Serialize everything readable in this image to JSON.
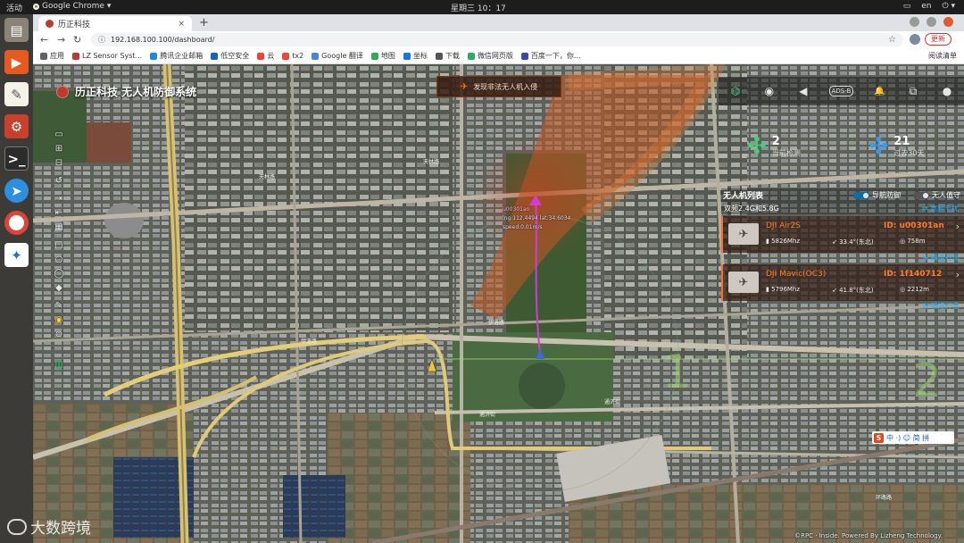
{
  "system_bar": {
    "activities": "活动",
    "app_name": "Google Chrome",
    "clock": "星期三 10：17",
    "lang": "en"
  },
  "browser": {
    "tab_title": "历正科技",
    "tab_close": "×",
    "new_tab": "+",
    "url": "192.168.100.100/dashboard/",
    "update_label": "更新",
    "bookmarks": [
      {
        "label": "应用",
        "color": "#5f6368"
      },
      {
        "label": "LZ Sensor Syst...",
        "color": "#c0392b"
      },
      {
        "label": "腾讯企业邮箱",
        "color": "#1e88e5"
      },
      {
        "label": "低空安全",
        "color": "#1565c0"
      },
      {
        "label": "云",
        "color": "#f44336"
      },
      {
        "label": "tx2",
        "color": "#f44336"
      },
      {
        "label": "Google 翻译",
        "color": "#4285f4"
      },
      {
        "label": "地图",
        "color": "#34a853"
      },
      {
        "label": "坐标",
        "color": "#1a73e8"
      },
      {
        "label": "下载",
        "color": "#555555"
      },
      {
        "label": "微信网页版",
        "color": "#2aae67"
      },
      {
        "label": "百度一下，你...",
        "color": "#3949ab"
      }
    ],
    "reading_list": "阅读清单"
  },
  "app": {
    "brand": "历正科技 无人机防御系统",
    "alert_text": "发现非法无人机入侵",
    "right_tools": [
      {
        "name": "radar-icon",
        "glyph": "⌬",
        "active": true
      },
      {
        "name": "eye-icon",
        "glyph": "◉",
        "active": false
      },
      {
        "name": "speaker-icon",
        "glyph": "◀",
        "active": false
      },
      {
        "name": "adsb-icon",
        "glyph": "ADS-B",
        "active": false
      },
      {
        "name": "bell-icon",
        "glyph": "🔔",
        "active": false
      },
      {
        "name": "layers-icon",
        "glyph": "⧉",
        "active": false
      },
      {
        "name": "user-icon",
        "glyph": "●",
        "active": false
      }
    ],
    "stats": {
      "current": {
        "value": "2",
        "label": "当前检测",
        "color": "#37d67a"
      },
      "past30": {
        "value": "21",
        "label": "过去30天",
        "color": "#2a9cff"
      }
    },
    "panel": {
      "title": "无人机列表",
      "nav_defense": "导航防御",
      "unmanned_guard": "无人值守",
      "band": "双频2.4G和5.8G",
      "wideband": "宽频干扰",
      "drones": [
        {
          "name": "DJI Air2S",
          "id": "ID: u00301an",
          "mhz": "5826Mhz",
          "dir": "33.4°(东北)",
          "dist": "758m",
          "strike": "精准打击"
        },
        {
          "name": "DJI Mavic(OC3)",
          "id": "ID: 1f140712",
          "mhz": "5796Mhz",
          "dir": "41.8°(东北)",
          "dist": "2212m",
          "strike": "精准打击"
        }
      ]
    },
    "target": {
      "id": "u00301an",
      "coords": "lng:112.4494 lat:34.6034",
      "speed": "speed:0.01m/s"
    },
    "sectors": [
      "1",
      "2"
    ],
    "road_labels": [
      "伊洛路",
      "伊洛路",
      "天林路",
      "天林路",
      "通济街",
      "通济街",
      "环路路"
    ],
    "ime": "中 ·) ☺ 简 拼",
    "footer": "©RPC · Inside. Powered By Lizheng Technology.",
    "watermark": "大数跨境"
  },
  "left_tools": [
    "layers-icon",
    "zoom-in-icon",
    "zoom-out-icon",
    "refresh-icon",
    "import-icon",
    "export-icon",
    "trash-icon",
    "square-icon",
    "circle-icon",
    "polygon-icon",
    "eraser-icon",
    "pen-icon",
    "warning-icon",
    "target-icon",
    "battery-icon"
  ]
}
